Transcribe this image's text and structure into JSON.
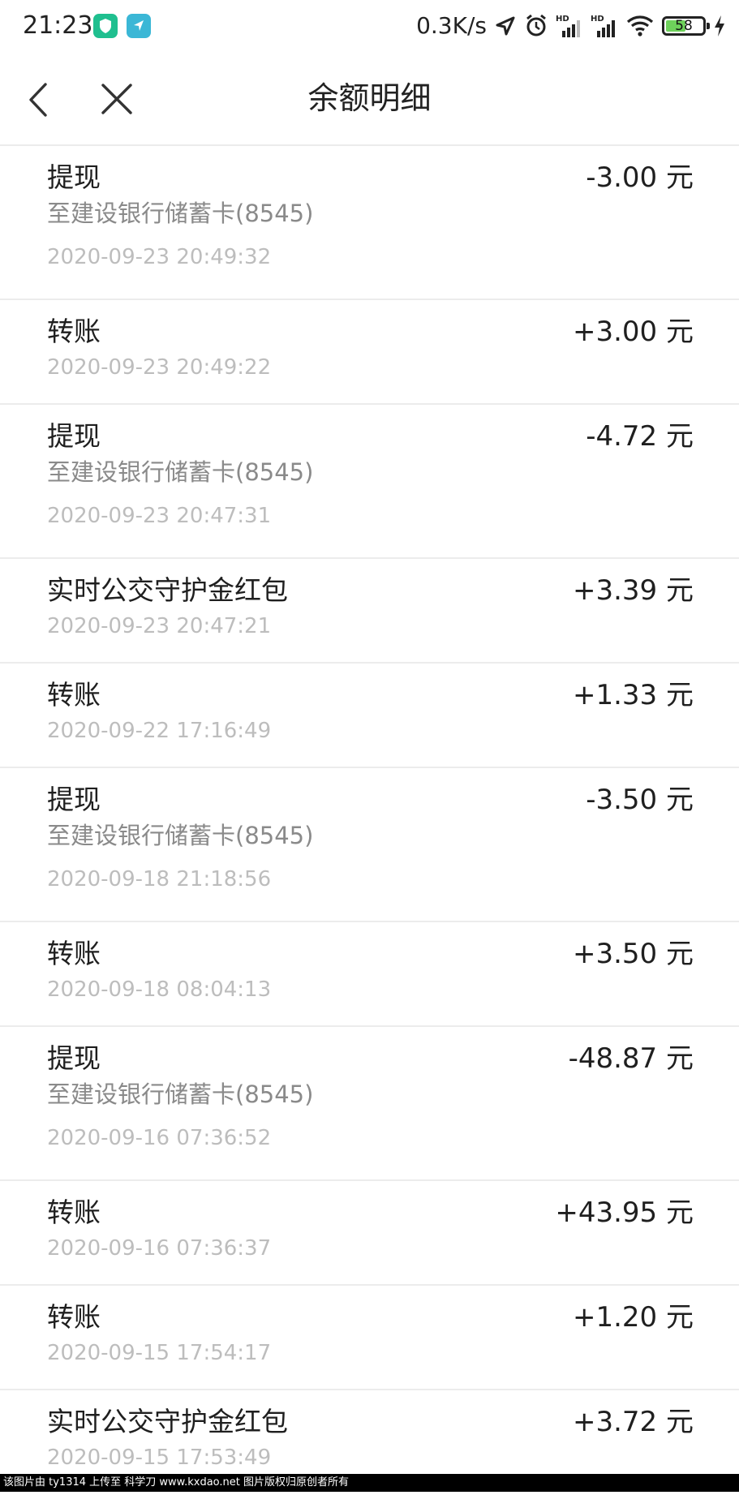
{
  "status_bar": {
    "time": "21:23",
    "net_speed": "0.3K/s",
    "battery": "58",
    "battery_level": 0.58
  },
  "header": {
    "title": "余额明细"
  },
  "transactions": [
    {
      "title": "提现",
      "desc": "至建设银行储蓄卡(8545)",
      "time": "2020-09-23 20:49:32",
      "amount": "-3.00 元"
    },
    {
      "title": "转账",
      "time": "2020-09-23 20:49:22",
      "amount": "+3.00 元"
    },
    {
      "title": "提现",
      "desc": "至建设银行储蓄卡(8545)",
      "time": "2020-09-23 20:47:31",
      "amount": "-4.72 元"
    },
    {
      "title": "实时公交守护金红包",
      "time": "2020-09-23 20:47:21",
      "amount": "+3.39 元"
    },
    {
      "title": "转账",
      "time": "2020-09-22 17:16:49",
      "amount": "+1.33 元"
    },
    {
      "title": "提现",
      "desc": "至建设银行储蓄卡(8545)",
      "time": "2020-09-18 21:18:56",
      "amount": "-3.50 元"
    },
    {
      "title": "转账",
      "time": "2020-09-18 08:04:13",
      "amount": "+3.50 元"
    },
    {
      "title": "提现",
      "desc": "至建设银行储蓄卡(8545)",
      "time": "2020-09-16 07:36:52",
      "amount": "-48.87 元"
    },
    {
      "title": "转账",
      "time": "2020-09-16 07:36:37",
      "amount": "+43.95 元"
    },
    {
      "title": "转账",
      "time": "2020-09-15 17:54:17",
      "amount": "+1.20 元"
    },
    {
      "title": "实时公交守护金红包",
      "time": "2020-09-15 17:53:49",
      "amount": "+3.72 元"
    }
  ],
  "footer": {
    "watermark": "该图片由 ty1314 上传至 科学刀 www.kxdao.net 图片版权归原创者所有"
  },
  "colors": {
    "divider": "#ececec",
    "secondary_text": "#8a8a8a",
    "time_text": "#bdbdbd",
    "battery_fill": "#6ed15b"
  }
}
